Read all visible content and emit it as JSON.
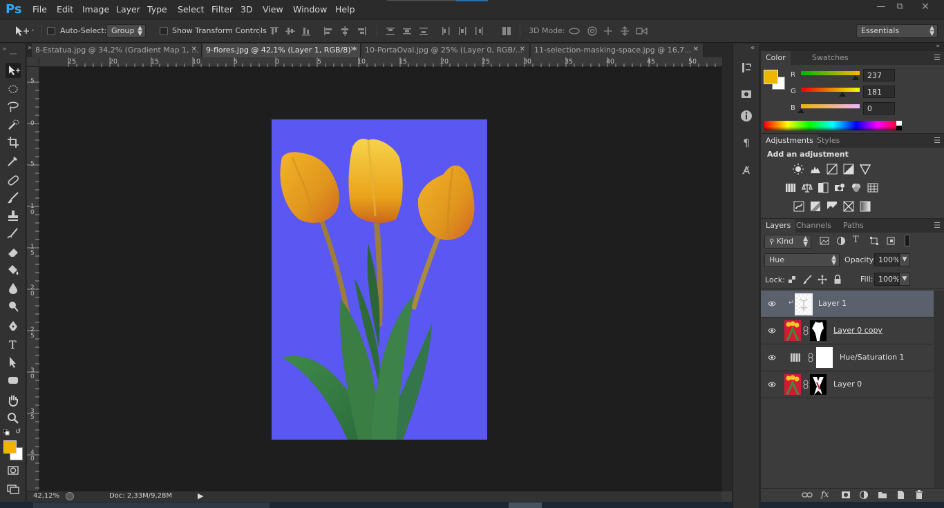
{
  "app": {
    "logo": "Ps"
  },
  "menu": [
    "File",
    "Edit",
    "Image",
    "Layer",
    "Type",
    "Select",
    "Filter",
    "3D",
    "View",
    "Window",
    "Help"
  ],
  "window_controls": [
    "minimize-icon",
    "restore-icon",
    "close-icon"
  ],
  "options": {
    "auto_select_label": "Auto-Select:",
    "auto_select_value": "Group",
    "show_transform_label": "Show Transform Controls",
    "mode_3d_label": "3D Mode:",
    "workspace": "Essentials"
  },
  "tabs": [
    {
      "label": "8-Estatua.jpg @ 34,2% (Gradient Map 1, ...",
      "active": false
    },
    {
      "label": "9-flores.jpg @ 42,1% (Layer 1, RGB/8) *",
      "active": true
    },
    {
      "label": "10-PortaOval.jpg @ 25% (Layer 0, RGB/...",
      "active": false
    },
    {
      "label": "11-selection-masking-space.jpg @ 16,7...",
      "active": false
    }
  ],
  "ruler_top": [
    "25",
    "20",
    "15",
    "10",
    "5",
    "0",
    "5",
    "10",
    "15",
    "20",
    "25",
    "30",
    "35",
    "40",
    "45",
    "50"
  ],
  "ruler_left": [
    "5",
    "0",
    "5",
    "1\n0",
    "1\n5",
    "2\n0",
    "2\n5",
    "3\n0",
    "3\n5",
    "4\n0"
  ],
  "status": {
    "zoom": "42,12%",
    "doc": "Doc: 2,33M/9,28M"
  },
  "color_panel": {
    "tabs": [
      "Color",
      "Swatches"
    ],
    "foreground": "#edb500",
    "background": "#ffffff",
    "r_label": "R",
    "r_value": "237",
    "g_label": "G",
    "g_value": "181",
    "b_label": "B",
    "b_value": "0"
  },
  "adjustments_panel": {
    "tabs": [
      "Adjustments",
      "Styles"
    ],
    "heading": "Add an adjustment"
  },
  "layers_panel": {
    "tabs": [
      "Layers",
      "Channels",
      "Paths"
    ],
    "filter_kind": "Kind",
    "blend_mode": "Hue",
    "opacity_label": "Opacity:",
    "opacity_value": "100%",
    "lock_label": "Lock:",
    "fill_label": "Fill:",
    "fill_value": "100%",
    "layers": [
      {
        "name": "Layer 1",
        "selected": true
      },
      {
        "name": "Layer 0 copy",
        "selected": false
      },
      {
        "name": "Hue/Saturation 1",
        "selected": false
      },
      {
        "name": "Layer 0",
        "selected": false
      }
    ]
  }
}
